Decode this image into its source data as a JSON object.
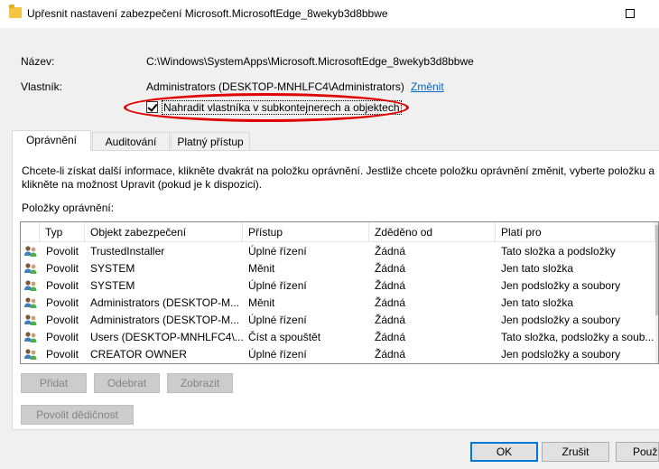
{
  "window": {
    "title": "Upřesnit nastavení zabezpečení Microsoft.MicrosoftEdge_8wekyb3d8bbwe"
  },
  "info": {
    "name_label": "Název:",
    "name_value": "C:\\Windows\\SystemApps\\Microsoft.MicrosoftEdge_8wekyb3d8bbwe",
    "owner_label": "Vlastník:",
    "owner_value": "Administrators (DESKTOP-MNHLFC4\\Administrators)",
    "change_link": "Změnit",
    "replace_owner_checkbox": "Nahradit vlastníka v subkontejnerech a objektech",
    "replace_owner_checked": true
  },
  "tabs": [
    "Oprávnění",
    "Auditování",
    "Platný přístup"
  ],
  "active_tab": "Oprávnění",
  "panel": {
    "info_text_line1": "Chcete-li získat další informace, klikněte dvakrát na položku oprávnění. Jestliže chcete položku oprávnění změnit, vyberte položku a",
    "info_text_line2": "klikněte na možnost Upravit (pokud je k dispozici).",
    "entries_label": "Položky oprávnění:"
  },
  "table": {
    "columns": [
      "Typ",
      "Objekt zabezpečení",
      "Přístup",
      "Zděděno od",
      "Platí pro"
    ],
    "rows": [
      [
        "Povolit",
        "TrustedInstaller",
        "Úplné řízení",
        "Žádná",
        "Tato složka a podsložky"
      ],
      [
        "Povolit",
        "SYSTEM",
        "Měnit",
        "Žádná",
        "Jen tato složka"
      ],
      [
        "Povolit",
        "SYSTEM",
        "Úplné řízení",
        "Žádná",
        "Jen podsložky a soubory"
      ],
      [
        "Povolit",
        "Administrators (DESKTOP-M...",
        "Měnit",
        "Žádná",
        "Jen tato složka"
      ],
      [
        "Povolit",
        "Administrators (DESKTOP-M...",
        "Úplné řízení",
        "Žádná",
        "Jen podsložky a soubory"
      ],
      [
        "Povolit",
        "Users (DESKTOP-MNHLFC4\\...",
        "Číst a spouštět",
        "Žádná",
        "Tato složka, podsložky a soub..."
      ],
      [
        "Povolit",
        "CREATOR OWNER",
        "Úplné řízení",
        "Žádná",
        "Jen podsložky a soubory"
      ]
    ]
  },
  "buttons": {
    "add": "Přidat",
    "remove": "Odebrat",
    "view": "Zobrazit",
    "enable_inheritance": "Povolit dědičnost",
    "ok": "OK",
    "cancel": "Zrušit",
    "apply": "Použít"
  },
  "colors": {
    "highlight_ellipse": "#e00000",
    "link": "#0066cc"
  }
}
